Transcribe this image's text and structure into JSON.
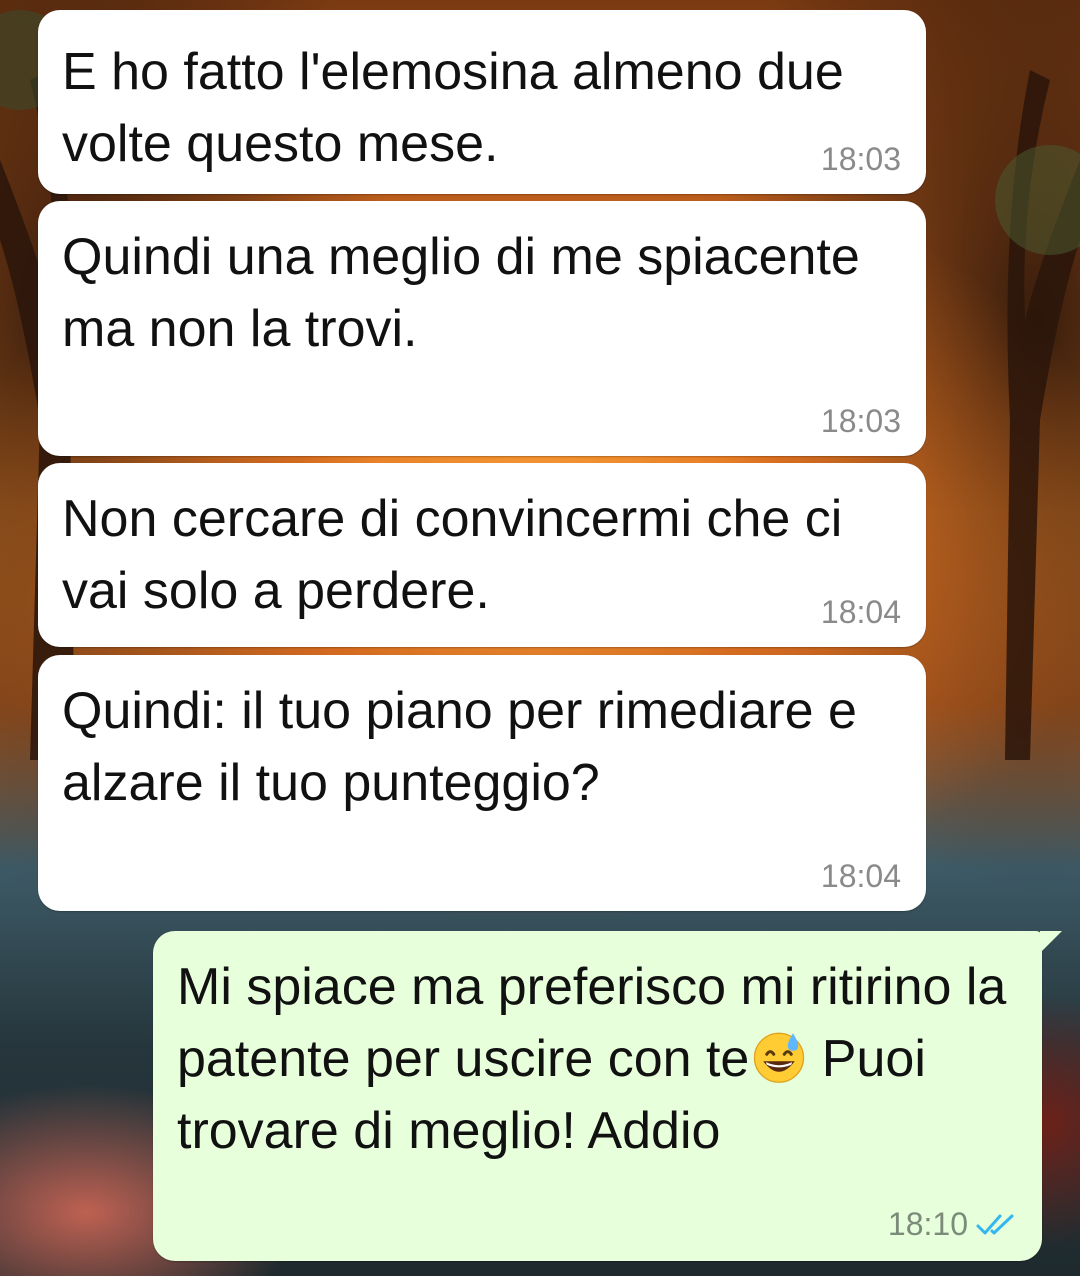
{
  "colors": {
    "incoming_bubble": "#ffffff",
    "outgoing_bubble": "#e7ffdb",
    "timestamp_gray": "#8a8a8a",
    "read_ticks_blue": "#34b7f1"
  },
  "messages": [
    {
      "direction": "incoming",
      "text": "E ho fatto l'elemosina almeno due volte questo mese.",
      "time": "18:03"
    },
    {
      "direction": "incoming",
      "text": "Quindi una meglio di me spiacente ma non la trovi.",
      "time": "18:03"
    },
    {
      "direction": "incoming",
      "text": "Non cercare di convincermi che ci vai solo a perdere.",
      "time": "18:04"
    },
    {
      "direction": "incoming",
      "text": "Quindi: il tuo piano per rimediare e alzare il tuo punteggio?",
      "time": "18:04"
    },
    {
      "direction": "outgoing",
      "text_before_emoji": "Mi spiace ma preferisco mi ritirino la patente per uscire con te",
      "emoji": "grinning-face-with-sweat",
      "text_after_emoji": " Puoi trovare di meglio! Addio",
      "time": "18:10",
      "status_icon": "double-check-read-icon"
    }
  ]
}
